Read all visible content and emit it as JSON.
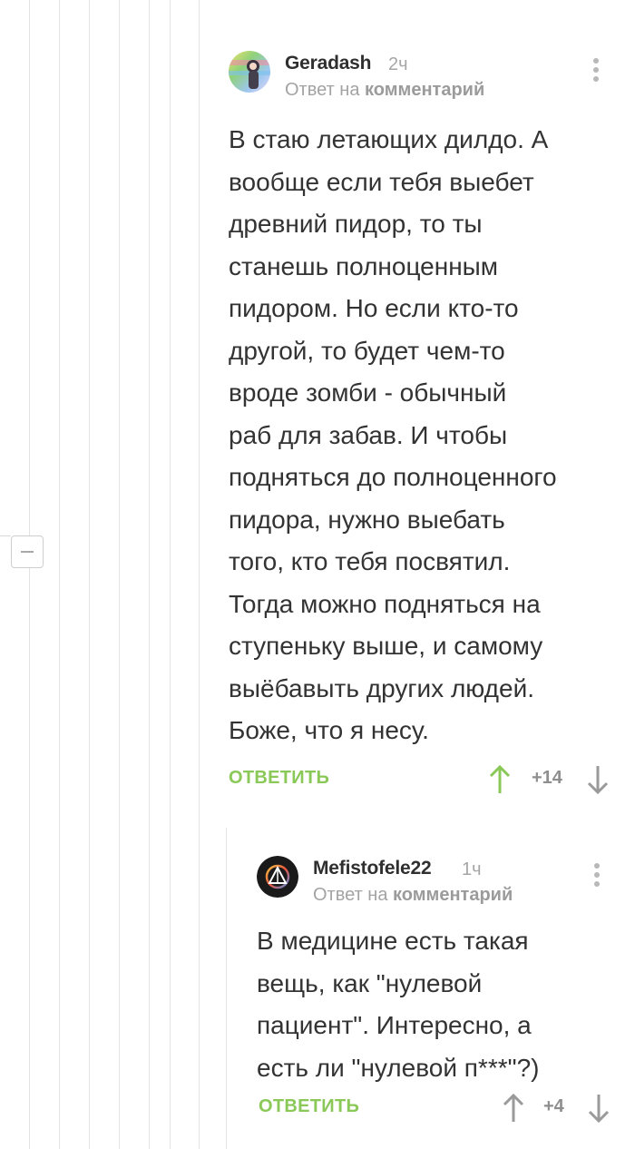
{
  "thread": {
    "collapse_icon": "minus-icon"
  },
  "comments": [
    {
      "author": "Geradash",
      "time": "2ч",
      "reply_prefix": "Ответ на",
      "reply_link": "комментарий",
      "text": "В стаю летающих дилдо. А\nвообще если тебя выебет\nдревний пидор, то ты\nстанешь полноценным\nпидором. Но если кто-то\nдругой, то будет чем-то\nвроде зомби - обычный\nраб для забав. И чтобы\nподняться до полноценного\nпидора, нужно выебать\nтого, кто тебя посвятил.\nТогда можно подняться на\nступеньку выше, и самому\nвыёбавыть других людей.\nБоже, что я несу.",
      "reply_label": "ОТВЕТИТЬ",
      "rating": "+14"
    },
    {
      "author": "Mefistofele22",
      "time": "1ч",
      "reply_prefix": "Ответ на",
      "reply_link": "комментарий",
      "text": "В медицине есть такая\nвещь, как \"нулевой\nпациент\". Интересно, а\nесть ли \"нулевой п***\"?)",
      "reply_label": "ОТВЕТИТЬ",
      "rating": "+4"
    }
  ],
  "colors": {
    "accent_green": "#8ac858",
    "thread_line": "#e3e3e3",
    "muted_text": "#a3a3a3"
  }
}
